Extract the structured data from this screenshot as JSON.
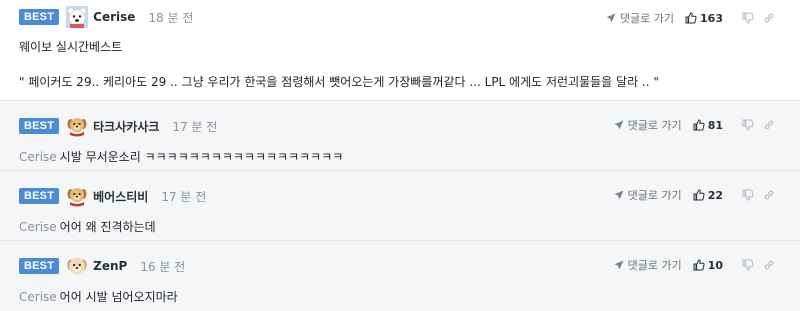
{
  "colors": {
    "best_badge": "#4b8ad6",
    "reply_background": "#f4f6f8",
    "divider": "#e2e6eb"
  },
  "icons": {
    "reply": "send-arrow-icon",
    "like": "thumbs-up-icon",
    "dislike": "thumbs-down-icon",
    "share": "link-icon"
  },
  "comments": [
    {
      "badge": "BEST",
      "avatar": "polar-bear-avatar",
      "nickname": "Cerise",
      "time": "18 분 전",
      "reply_label": "댓글로 가기",
      "likes": "163",
      "lines": [
        "웨이보 실시간베스트",
        "\" 페이커도 29.. 케리아도 29 .. 그냥 우리가 한국을 점령해서 뺏어오는게 가장빠를꺼같다 ... LPL 에게도 저런괴물들을 달라 .. \""
      ]
    },
    {
      "badge": "BEST",
      "avatar": "puppy-scarf-avatar",
      "nickname": "타크사카사크",
      "time": "17 분 전",
      "reply_label": "댓글로 가기",
      "likes": "81",
      "mention": "Cerise",
      "text": "시발 무서운소리 ㅋㅋㅋㅋㅋㅋㅋㅋㅋㅋㅋㅋㅋㅋㅋㅋㅋㅋ"
    },
    {
      "badge": "BEST",
      "avatar": "puppy-scarf-avatar",
      "nickname": "베어스티비",
      "time": "17 분 전",
      "reply_label": "댓글로 가기",
      "likes": "22",
      "mention": "Cerise",
      "text": "어어 왜 진격하는데"
    },
    {
      "badge": "BEST",
      "avatar": "puppy-avatar",
      "nickname": "ZenP",
      "time": "16 분 전",
      "reply_label": "댓글로 가기",
      "likes": "10",
      "mention": "Cerise",
      "text": "어어 시발 넘어오지마라"
    }
  ]
}
